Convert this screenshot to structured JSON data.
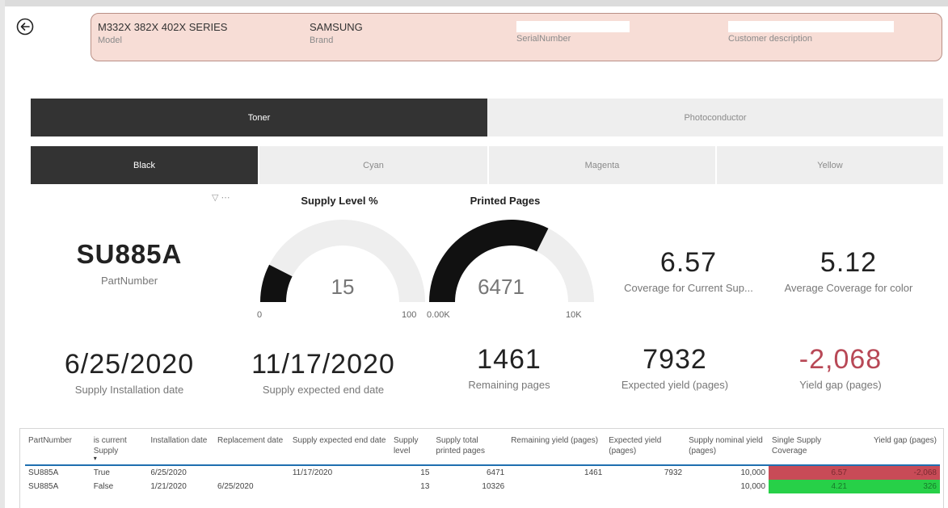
{
  "header": {
    "model": {
      "value": "M332X 382X 402X SERIES",
      "label": "Model"
    },
    "brand": {
      "value": "SAMSUNG",
      "label": "Brand"
    },
    "serial": {
      "value": "",
      "label": "SerialNumber"
    },
    "customer": {
      "value": "",
      "label": "Customer description"
    }
  },
  "supply_tabs": [
    {
      "label": "Toner",
      "active": true
    },
    {
      "label": "Photoconductor",
      "active": false
    }
  ],
  "color_tabs": [
    {
      "label": "Black",
      "active": true
    },
    {
      "label": "Cyan",
      "active": false
    },
    {
      "label": "Magenta",
      "active": false
    },
    {
      "label": "Yellow",
      "active": false
    }
  ],
  "filter_icons": "▽ ⋯",
  "part_number": {
    "value": "SU885A",
    "label": "PartNumber"
  },
  "supply_gauge": {
    "title": "Supply Level %",
    "value": 15,
    "display": "15",
    "min": 0,
    "max": 100,
    "min_label": "0",
    "max_label": "100"
  },
  "pages_gauge": {
    "title": "Printed Pages",
    "value": 6471,
    "display": "6471",
    "min": 0,
    "max": 10000,
    "min_label": "0.00K",
    "max_label": "10K"
  },
  "coverage_current": {
    "value": "6.57",
    "label": "Coverage for Current Sup..."
  },
  "coverage_avg": {
    "value": "5.12",
    "label": "Average Coverage for color"
  },
  "install_date": {
    "value": "6/25/2020",
    "label": "Supply Installation date"
  },
  "end_date": {
    "value": "11/17/2020",
    "label": "Supply expected end date"
  },
  "remaining": {
    "value": "1461",
    "label": "Remaining pages"
  },
  "expected_yield": {
    "value": "7932",
    "label": "Expected yield (pages)"
  },
  "yield_gap": {
    "value": "-2,068",
    "label": "Yield gap (pages)"
  },
  "colors": {
    "dark": "#333333",
    "tab_inactive": "#eeeeee",
    "header_bg": "#f7ddd6",
    "negative": "#b84856",
    "bad_cell": "#c84b57",
    "good_cell": "#27d048",
    "table_rule": "#1f6fb0"
  },
  "table": {
    "columns": [
      "PartNumber",
      "is current Supply",
      "Installation date",
      "Replacement date",
      "Supply expected end date",
      "Supply level",
      "Supply total printed pages",
      "Remaining yield (pages)",
      "Expected yield (pages)",
      "Supply nominal yield (pages)",
      "Single Supply Coverage",
      "Yield gap (pages)"
    ],
    "rows": [
      {
        "part": "SU885A",
        "current": "True",
        "install": "6/25/2020",
        "replace": "",
        "end": "11/17/2020",
        "level": "15",
        "printed": "6471",
        "remaining": "1461",
        "expected": "7932",
        "nominal": "10,000",
        "coverage": "6.57",
        "gap": "-2,068",
        "status": "bad"
      },
      {
        "part": "SU885A",
        "current": "False",
        "install": "1/21/2020",
        "replace": "6/25/2020",
        "end": "",
        "level": "13",
        "printed": "10326",
        "remaining": "",
        "expected": "",
        "nominal": "10,000",
        "coverage": "4.21",
        "gap": "326",
        "status": "good"
      }
    ]
  }
}
